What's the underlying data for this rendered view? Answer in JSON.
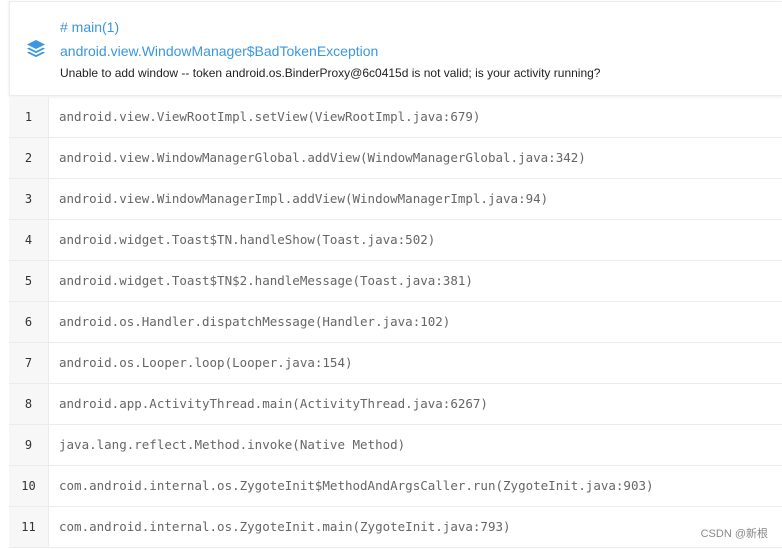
{
  "header": {
    "icon": "layers-icon",
    "thread": "# main(1)",
    "exception": "android.view.WindowManager$BadTokenException",
    "message": "Unable to add window -- token android.os.BinderProxy@6c0415d is not valid; is your activity running?"
  },
  "colors": {
    "accent": "#3a97e0",
    "frame_text": "#666666",
    "gutter": "#f7f7f7",
    "border": "#ececec"
  },
  "frames": [
    {
      "num": "1",
      "text": "android.view.ViewRootImpl.setView(ViewRootImpl.java:679)"
    },
    {
      "num": "2",
      "text": "android.view.WindowManagerGlobal.addView(WindowManagerGlobal.java:342)"
    },
    {
      "num": "3",
      "text": "android.view.WindowManagerImpl.addView(WindowManagerImpl.java:94)"
    },
    {
      "num": "4",
      "text": "android.widget.Toast$TN.handleShow(Toast.java:502)"
    },
    {
      "num": "5",
      "text": "android.widget.Toast$TN$2.handleMessage(Toast.java:381)"
    },
    {
      "num": "6",
      "text": "android.os.Handler.dispatchMessage(Handler.java:102)"
    },
    {
      "num": "7",
      "text": "android.os.Looper.loop(Looper.java:154)"
    },
    {
      "num": "8",
      "text": "android.app.ActivityThread.main(ActivityThread.java:6267)"
    },
    {
      "num": "9",
      "text": "java.lang.reflect.Method.invoke(Native Method)"
    },
    {
      "num": "10",
      "text": "com.android.internal.os.ZygoteInit$MethodAndArgsCaller.run(ZygoteInit.java:903)"
    },
    {
      "num": "11",
      "text": "com.android.internal.os.ZygoteInit.main(ZygoteInit.java:793)"
    }
  ],
  "watermark": "CSDN @新根"
}
